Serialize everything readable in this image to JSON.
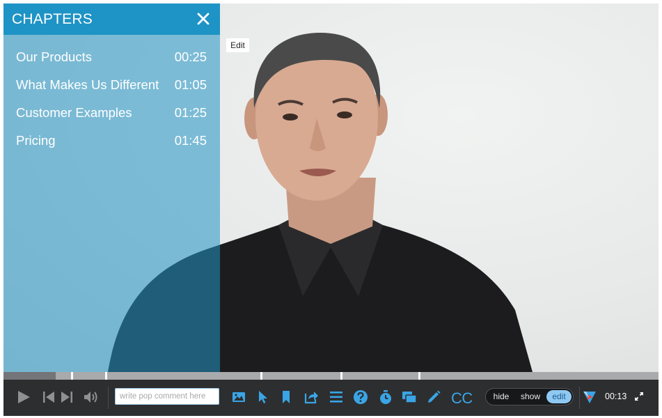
{
  "chapters_panel": {
    "title": "CHAPTERS",
    "items": [
      {
        "label": "Our Products",
        "time": "00:25"
      },
      {
        "label": "What Makes Us Different",
        "time": "01:05"
      },
      {
        "label": "Customer Examples",
        "time": "01:25"
      },
      {
        "label": "Pricing",
        "time": "01:45"
      }
    ]
  },
  "video": {
    "edit_label": "Edit"
  },
  "progress": {
    "played_fraction": 0.08
  },
  "controls": {
    "comment_placeholder": "write pop comment here",
    "cc_label": "CC",
    "mode_options": [
      "hide",
      "show",
      "edit"
    ],
    "active_mode": "edit",
    "current_time": "00:13",
    "icons": [
      "play-icon",
      "skip-back-icon",
      "skip-forward-icon",
      "volume-icon",
      "image-icon",
      "pointer-icon",
      "bookmark-icon",
      "share-icon",
      "list-icon",
      "question-icon",
      "timer-icon",
      "chat-icon",
      "pencil-icon",
      "brand-logo-icon",
      "fullscreen-icon"
    ]
  },
  "colors": {
    "panel_blue": "#1e93c5",
    "accent_blue": "#3aa5e6",
    "control_bar": "#2d2e30"
  }
}
